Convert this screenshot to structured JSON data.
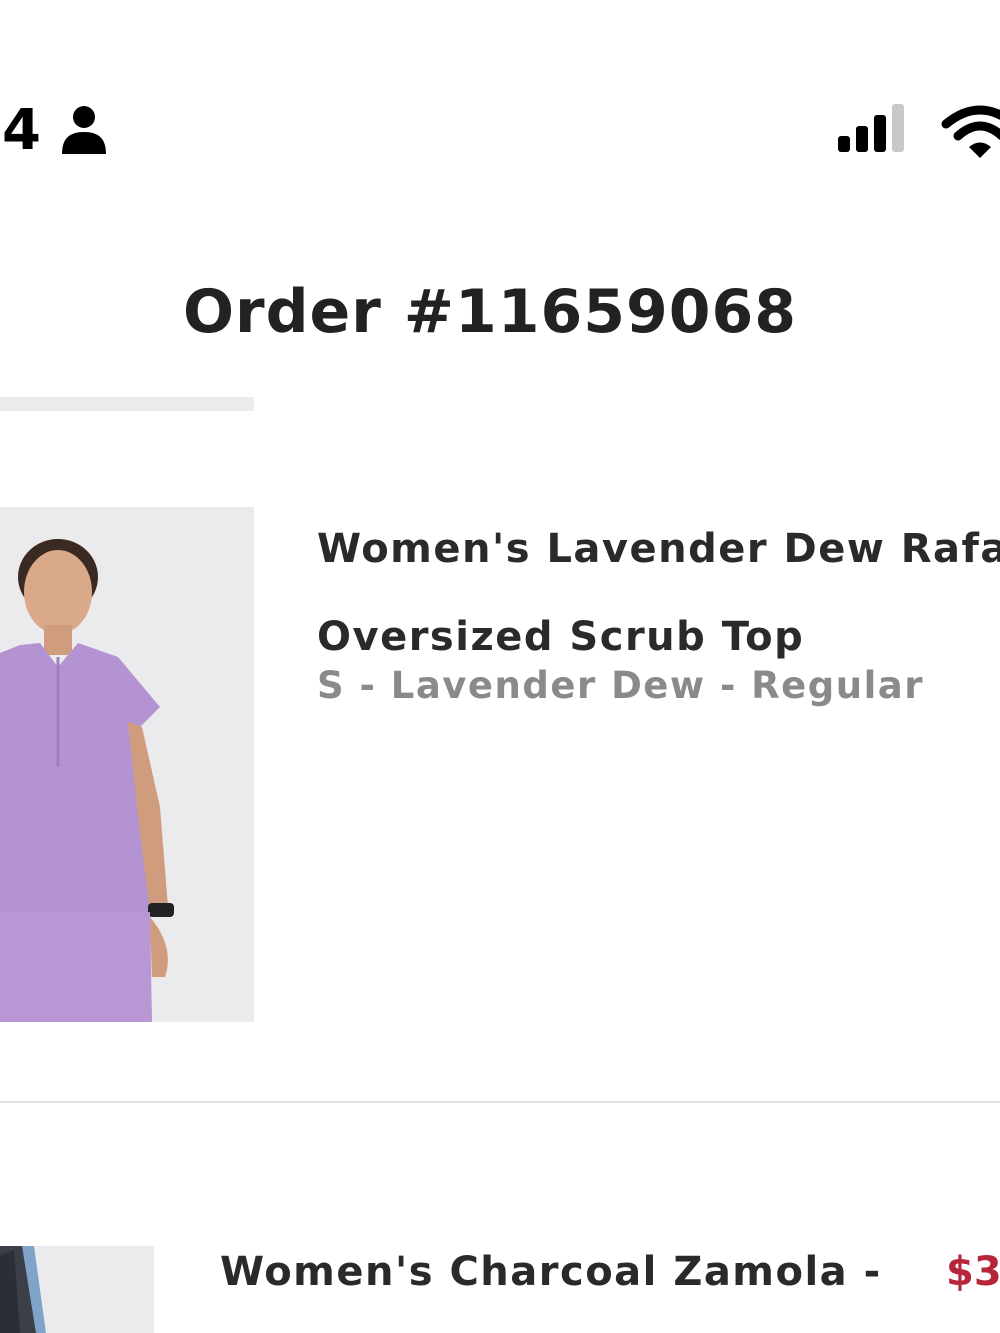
{
  "status_bar": {
    "time": "4",
    "icons": [
      "person-icon",
      "signal-icon",
      "wifi-icon"
    ]
  },
  "order": {
    "title": "Order #11659068"
  },
  "items": [
    {
      "name": "Women's Lavender Dew Rafae\nOversized Scrub Top",
      "variant": "S - Lavender Dew - Regular",
      "image": "lavender-scrub-top-photo"
    },
    {
      "name": "Women's Charcoal Zamola -",
      "price": "$3",
      "image": "charcoal-zamola-photo"
    }
  ],
  "colors": {
    "title": "#222222",
    "variant": "#8a8a8a",
    "price": "#b5263a",
    "scrub": "#b393d1",
    "image_bg": "#ebebed"
  }
}
